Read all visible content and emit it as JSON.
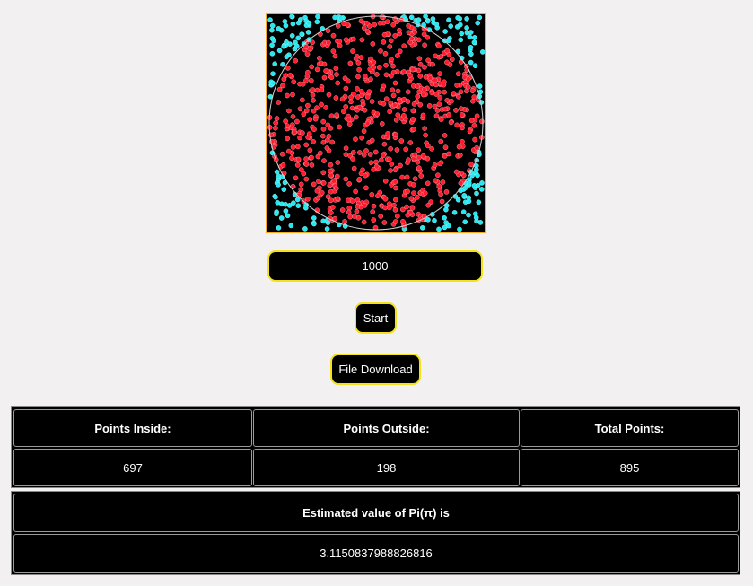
{
  "simulation": {
    "input_value": "1000",
    "start_label": "Start",
    "download_label": "File Download",
    "colors": {
      "canvas_border": "#f5a623",
      "inside_point": "#ff1a2e",
      "outside_point": "#24e8f0",
      "circle_outline": "#cfcfcf",
      "button_border": "#f4e11b"
    }
  },
  "stats": {
    "inside_header": "Points Inside:",
    "outside_header": "Points Outside:",
    "total_header": "Total Points:",
    "inside_value": "697",
    "outside_value": "198",
    "total_value": "895"
  },
  "estimate": {
    "header": "Estimated value of Pi(π) is",
    "value": "3.1150837988826816"
  }
}
